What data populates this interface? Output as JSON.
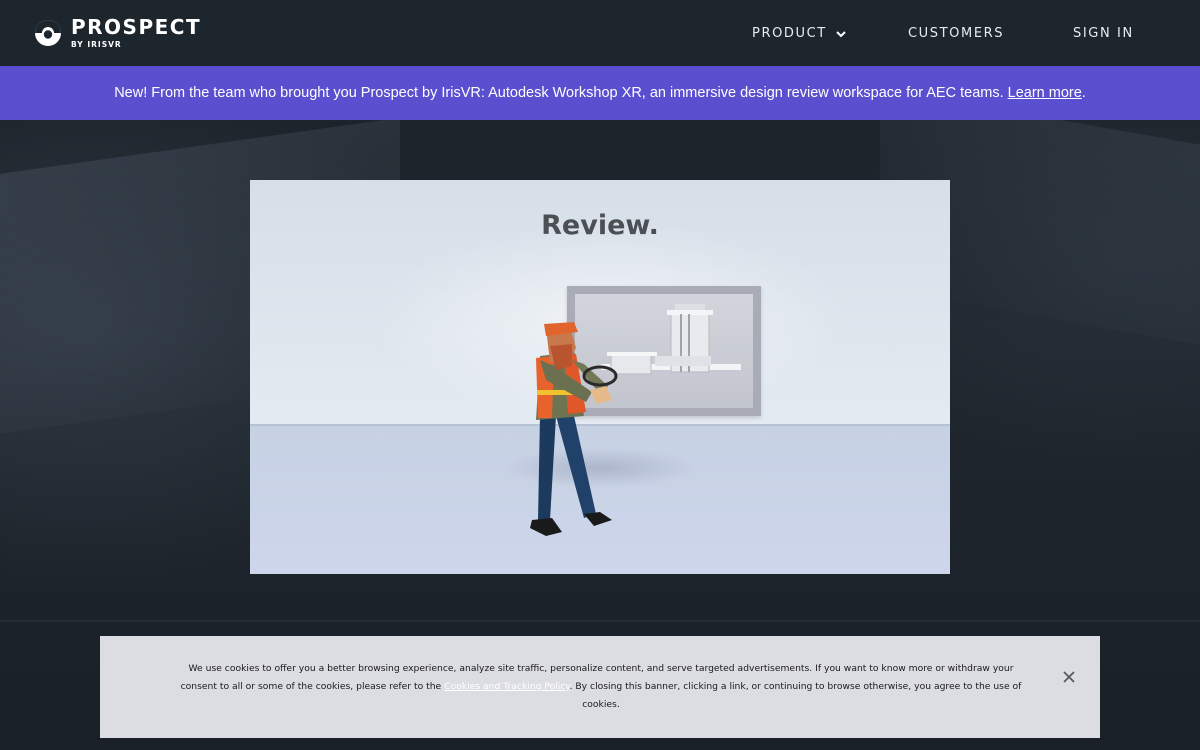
{
  "header": {
    "logo": {
      "name": "PROSPECT",
      "sub": "BY IRISVR"
    },
    "nav": {
      "product": "PRODUCT",
      "customers": "CUSTOMERS",
      "signin": "SIGN IN"
    }
  },
  "announcement": {
    "text": "New! From the team who brought you Prospect by IrisVR: Autodesk Workshop XR, an immersive design review workspace for AEC teams.",
    "link": "Learn more",
    "tail": "."
  },
  "video": {
    "title": "Review."
  },
  "cookie": {
    "text_before": "We use cookies to offer you a better browsing experience, analyze site traffic, personalize content, and serve targeted advertisements. If you want to know more or withdraw your consent to all or some of the cookies, please refer to the",
    "link": "Cookies and Tracking Policy",
    "text_after": ". By closing this banner, clicking a link, or continuing to browse otherwise, you agree to the use of cookies."
  },
  "colors": {
    "header_bg": "#1d252d",
    "announce_bg": "#5a4fcf",
    "cookie_bg": "#dcdde3"
  },
  "icons": {
    "logo": "prospect-logo-icon",
    "product_dropdown": "chevron-down-icon",
    "cookie_close": "close-icon"
  }
}
